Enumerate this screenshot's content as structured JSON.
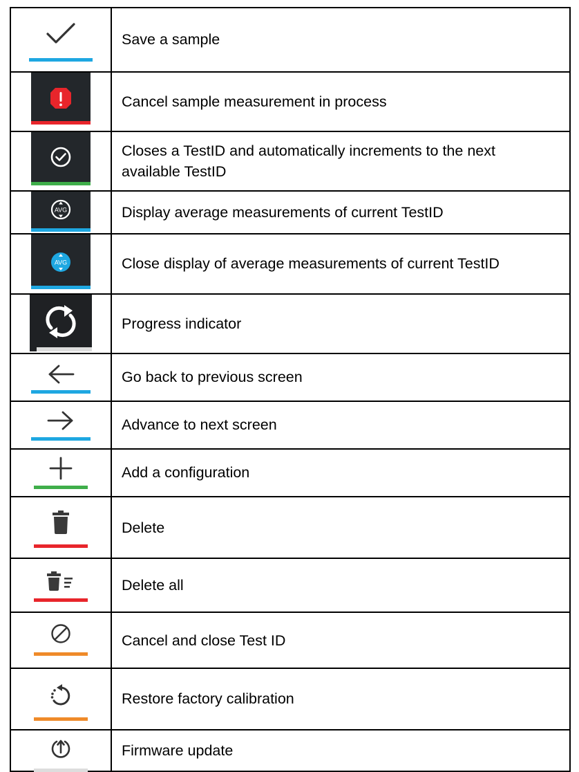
{
  "colors": {
    "blue": "#1ea7e1",
    "red": "#e8252b",
    "green": "#3fae4a",
    "orange": "#ef8a29",
    "dark": "#23272b",
    "gray": "#444444"
  },
  "rows": [
    {
      "icon": "checkmark-icon",
      "underline": "blue",
      "label": "Save a sample"
    },
    {
      "icon": "alert-octagon-icon",
      "underline": "red",
      "label": "Cancel sample measurement in process"
    },
    {
      "icon": "circle-check-icon",
      "underline": "green",
      "label": "Closes a TestID and automatically increments to the next available TestID"
    },
    {
      "icon": "avg-icon",
      "underline": "blue",
      "label": "Display average measurements of current TestID",
      "icon_text": "AVG"
    },
    {
      "icon": "avg-active-icon",
      "underline": "blue",
      "label": "Close display of average measurements of current TestID",
      "icon_text": "AVG"
    },
    {
      "icon": "sync-icon",
      "underline": "gray",
      "label": "Progress indicator"
    },
    {
      "icon": "arrow-left-icon",
      "underline": "blue",
      "label": "Go back to previous screen"
    },
    {
      "icon": "arrow-right-icon",
      "underline": "blue",
      "label": "Advance to next screen"
    },
    {
      "icon": "plus-icon",
      "underline": "green",
      "label": "Add a configuration"
    },
    {
      "icon": "trash-icon",
      "underline": "red",
      "label": "Delete"
    },
    {
      "icon": "delete-all-icon",
      "underline": "red",
      "label": "Delete all"
    },
    {
      "icon": "cancel-circle-icon",
      "underline": "orange",
      "label": "Cancel and close Test ID"
    },
    {
      "icon": "restore-icon",
      "underline": "orange",
      "label": "Restore factory calibration"
    },
    {
      "icon": "firmware-update-icon",
      "underline": "gray",
      "label": "Firmware update"
    }
  ]
}
